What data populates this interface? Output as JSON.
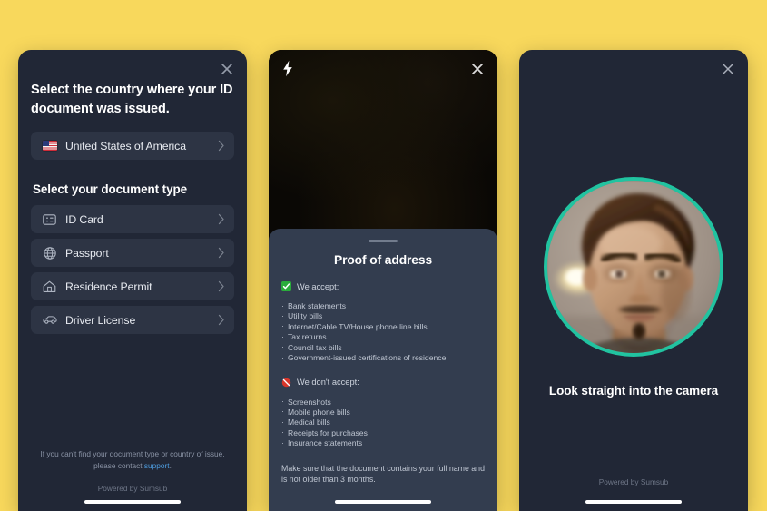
{
  "theme": {
    "page_background": "#F8D85C",
    "panel_background": "#212736",
    "row_background": "#2D3444",
    "sheet_background": "#333D4F",
    "accent_green": "#21C3A0",
    "link_blue": "#4E9DE0"
  },
  "panel_document_select": {
    "close_label": "Close",
    "title": "Select the country where your ID document was issued.",
    "country_row": {
      "label": "United States of America",
      "icon": "flag-us-icon"
    },
    "subtitle": "Select your document type",
    "document_types": [
      {
        "label": "ID Card",
        "icon": "id-card-icon"
      },
      {
        "label": "Passport",
        "icon": "globe-icon"
      },
      {
        "label": "Residence Permit",
        "icon": "home-icon"
      },
      {
        "label": "Driver License",
        "icon": "car-icon"
      }
    ],
    "footnote_prefix": "If you can't find your document type or country of issue, please contact ",
    "footnote_link": "support",
    "footnote_suffix": ".",
    "powered_by": "Powered by Sumsub"
  },
  "panel_proof_of_address": {
    "close_label": "Close",
    "flash_label": "Flash",
    "sheet_title": "Proof of address",
    "accept": {
      "badge": "check-badge-icon",
      "heading": "We accept:",
      "items": [
        "Bank statements",
        "Utility bills",
        "Internet/Cable TV/House phone line bills",
        "Tax returns",
        "Council tax bills",
        "Government-issued certifications of residence"
      ]
    },
    "reject": {
      "badge": "prohibited-icon",
      "heading": "We don't accept:",
      "items": [
        "Screenshots",
        "Mobile phone bills",
        "Medical bills",
        "Receipts for purchases",
        "Insurance statements"
      ]
    },
    "note": "Make sure that the document contains your full name and is not older than 3 months."
  },
  "panel_liveness": {
    "close_label": "Close",
    "caption": "Look straight into the camera",
    "powered_by": "Powered by Sumsub"
  }
}
